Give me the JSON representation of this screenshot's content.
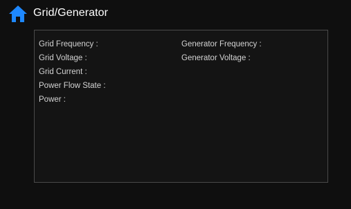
{
  "header": {
    "icon": "home-icon",
    "icon_color": "#1e88ff",
    "title": "Grid/Generator"
  },
  "panel": {
    "left_fields": [
      {
        "label": "Grid Frequency :"
      },
      {
        "label": "Grid Voltage :"
      },
      {
        "label": "Grid Current :"
      },
      {
        "label": "Power Flow State :"
      },
      {
        "label": "Power :"
      }
    ],
    "right_fields": [
      {
        "label": "Generator Frequency :"
      },
      {
        "label": "Generator Voltage :"
      }
    ]
  }
}
